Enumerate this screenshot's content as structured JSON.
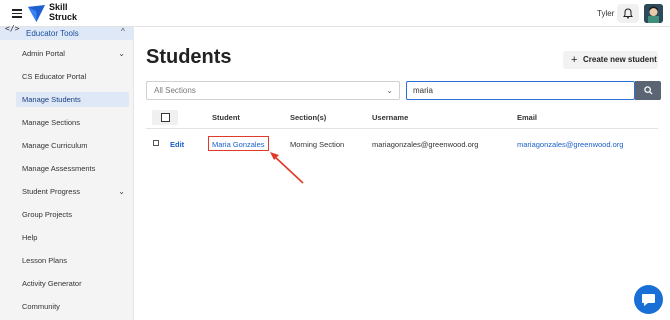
{
  "topbar": {
    "logo_line1": "Skill",
    "logo_line2": "Struck",
    "user_name": "Tyler"
  },
  "sidebar": {
    "section_title": "Educator Tools",
    "items": [
      {
        "label": "Admin Portal",
        "has_chevron": true
      },
      {
        "label": "CS Educator Portal"
      },
      {
        "label": "Manage Students",
        "active": true
      },
      {
        "label": "Manage Sections"
      },
      {
        "label": "Manage Curriculum"
      },
      {
        "label": "Manage Assessments"
      },
      {
        "label": "Student Progress",
        "has_chevron": true
      },
      {
        "label": "Group Projects"
      },
      {
        "label": "Help"
      },
      {
        "label": "Lesson Plans"
      },
      {
        "label": "Activity Generator"
      },
      {
        "label": "Community"
      }
    ]
  },
  "main": {
    "title": "Students",
    "create_button": "Create new student",
    "section_filter": "All Sections",
    "search_value": "maria"
  },
  "table": {
    "headers": [
      "Student",
      "Section(s)",
      "Username",
      "Email"
    ],
    "rows": [
      {
        "action": "Edit",
        "student": "Maria Gonzales",
        "section": "Morning Section",
        "username": "mariagonzales@greenwood.org",
        "email": "mariagonzales@greenwood.org"
      }
    ]
  },
  "colors": {
    "accent": "#1a5fc9",
    "highlight": "#e03a2a",
    "sidebar_active": "#dfe8f7"
  }
}
